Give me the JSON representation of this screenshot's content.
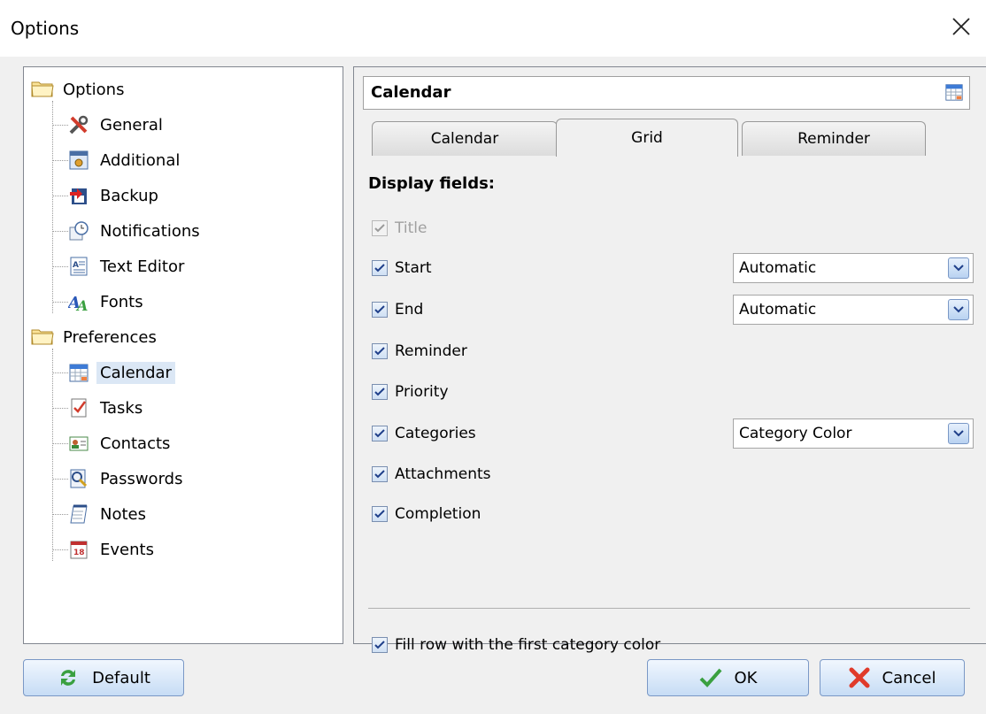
{
  "window": {
    "title": "Options"
  },
  "tree": {
    "groups": [
      {
        "label": "Options",
        "items": [
          "General",
          "Additional",
          "Backup",
          "Notifications",
          "Text Editor",
          "Fonts"
        ]
      },
      {
        "label": "Preferences",
        "items": [
          "Calendar",
          "Tasks",
          "Contacts",
          "Passwords",
          "Notes",
          "Events"
        ]
      }
    ],
    "selected": "Calendar"
  },
  "panel": {
    "header": "Calendar",
    "tabs": [
      "Calendar",
      "Grid",
      "Reminder"
    ],
    "active_tab": "Grid",
    "section_title": "Display fields:",
    "fields": [
      {
        "label": "Title",
        "checked": true,
        "disabled": true
      },
      {
        "label": "Start",
        "checked": true,
        "combo": "Automatic"
      },
      {
        "label": "End",
        "checked": true,
        "combo": "Automatic"
      },
      {
        "label": "Reminder",
        "checked": true
      },
      {
        "label": "Priority",
        "checked": true
      },
      {
        "label": "Categories",
        "checked": true,
        "combo": "Category Color"
      },
      {
        "label": "Attachments",
        "checked": true
      },
      {
        "label": "Completion",
        "checked": true
      }
    ],
    "fill_row": {
      "label": "Fill row with the first category color",
      "checked": true
    }
  },
  "buttons": {
    "default": "Default",
    "ok": "OK",
    "cancel": "Cancel"
  },
  "colors": {
    "selection": "#dbe7f5",
    "button_top": "#f1f7fe",
    "button_bottom": "#c6dcf5"
  }
}
